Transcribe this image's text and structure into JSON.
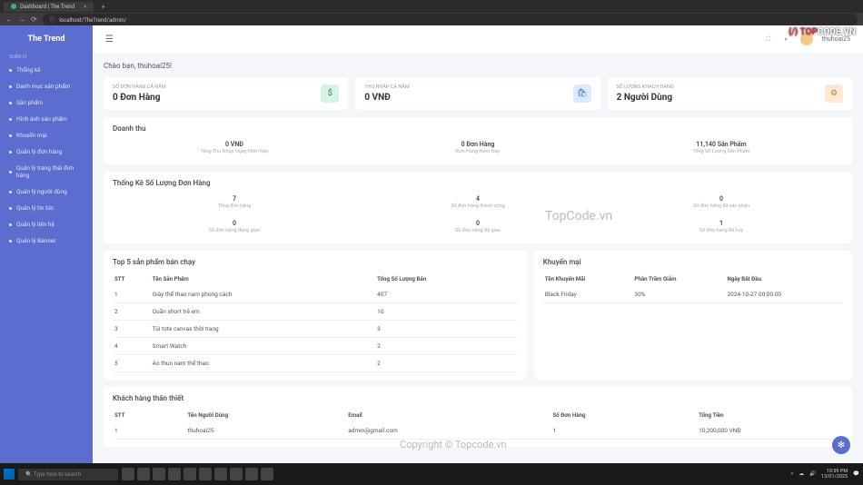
{
  "browser": {
    "tab_title": "Dashboard | The Trend",
    "url": "localhost/TheTrend/admin/"
  },
  "sidebar": {
    "logo": "The Trend",
    "section": "QUẢN LÝ",
    "items": [
      "Thống kê",
      "Danh mục sản phẩm",
      "Sản phẩm",
      "Hình ảnh sản phẩm",
      "Khuyến mại",
      "Quản lý đơn hàng",
      "Quản lý trạng thái đơn hàng",
      "Quản lý người dùng",
      "Quản lý tin tức",
      "Quản lý liên hệ",
      "Quản lý Banner"
    ]
  },
  "topbar": {
    "username": "thuhoai25"
  },
  "greeting": "Chào bạn, thuhoai25!",
  "stats": [
    {
      "label": "SỐ ĐƠN HÀNG CẢ NĂM",
      "value": "0 Đơn Hàng",
      "iconClass": "green",
      "icon": "$"
    },
    {
      "label": "THU NHẬP CẢ NĂM",
      "value": "0 VNĐ",
      "iconClass": "blue",
      "icon": "🛍"
    },
    {
      "label": "SỐ LƯỢNG KHÁCH HÀNG",
      "value": "2 Người Dùng",
      "iconClass": "orange",
      "icon": "⚙"
    }
  ],
  "revenue": {
    "title": "Doanh thu",
    "cols": [
      {
        "val": "0 VNĐ",
        "lbl": "Tổng Thu Nhập Ngày Hôm Nay"
      },
      {
        "val": "0 Đơn Hàng",
        "lbl": "Đơn Hàng Hôm Nay"
      },
      {
        "val": "11,140 Sản Phẩm",
        "lbl": "Tổng Số Lượng Sản Phẩm"
      }
    ]
  },
  "orderStats": {
    "title": "Thống Kê Số Lượng Đơn Hàng",
    "row1": [
      {
        "val": "7",
        "lbl": "Tổng đơn hàng"
      },
      {
        "val": "4",
        "lbl": "Số đơn hàng thành công"
      },
      {
        "val": "0",
        "lbl": "Số đơn hàng đã xác nhận"
      }
    ],
    "row2": [
      {
        "val": "0",
        "lbl": "Số đơn hàng đang giao"
      },
      {
        "val": "0",
        "lbl": "Số đơn hàng đã giao"
      },
      {
        "val": "1",
        "lbl": "Số đơn hàng đã hủy"
      }
    ]
  },
  "topProducts": {
    "title": "Top 5 sản phẩm bán chạy",
    "headers": {
      "stt": "STT",
      "name": "Tên Sản Phẩm",
      "qty": "Tổng Số Lượng Bán"
    },
    "rows": [
      {
        "stt": "1",
        "name": "Giày thể thao nam phong cách",
        "qty": "407"
      },
      {
        "stt": "2",
        "name": "Quần short trẻ em",
        "qty": "10"
      },
      {
        "stt": "3",
        "name": "Túi tote canvas thời trang",
        "qty": "3"
      },
      {
        "stt": "4",
        "name": "Smart Watch",
        "qty": "2"
      },
      {
        "stt": "5",
        "name": "Áo thun nam thể thao",
        "qty": "2"
      }
    ]
  },
  "promo": {
    "title": "Khuyến mại",
    "headers": {
      "name": "Tên Khuyến Mãi",
      "pct": "Phần Trăm Giảm",
      "date": "Ngày Bắt Đầu"
    },
    "rows": [
      {
        "name": "Black Friday",
        "pct": "30%",
        "date": "2024-10-27 00:00:00"
      }
    ]
  },
  "loyal": {
    "title": "Khách hàng thân thiết",
    "headers": {
      "stt": "STT",
      "name": "Tên Người Dùng",
      "email": "Email",
      "orders": "Số Đơn Hàng",
      "total": "Tổng Tiền"
    },
    "rows": [
      {
        "stt": "1",
        "name": "thuhoai25",
        "email": "admin@gmail.com",
        "orders": "1",
        "total": "10,200,000 VNĐ"
      }
    ]
  },
  "watermark": {
    "logo1": "{/} ",
    "logo2": "TOP",
    "logo3": "CODE.VN",
    "wm": "TopCode.vn",
    "copy": "Copyright © Topcode.vn"
  },
  "taskbar": {
    "search": "Type here to search",
    "time": "10:59 PM",
    "date": "13/01/2025"
  }
}
